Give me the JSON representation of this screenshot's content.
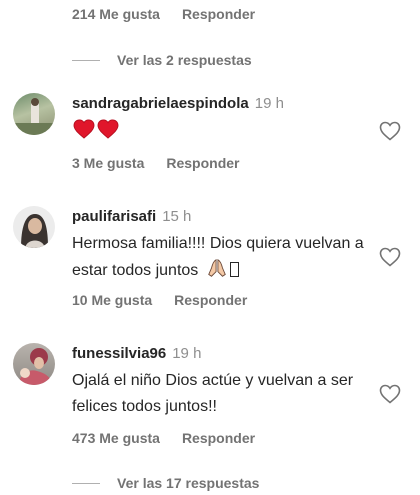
{
  "top": {
    "likes": "214 Me gusta",
    "reply": "Responder",
    "view_replies": "Ver las 2 respuestas"
  },
  "comments": [
    {
      "username": "sandragabrielaespindola",
      "time": "19 h",
      "text": "",
      "emoji_icons": [
        "red-heart-icon",
        "red-heart-icon"
      ],
      "likes": "3 Me gusta",
      "reply": "Responder"
    },
    {
      "username": "paulifarisafi",
      "time": "15 h",
      "text": "Hermosa familia!!!! Dios quiera vuelvan a estar todos juntos",
      "emoji_icons": [
        "praying-hands-icon",
        "missing-glyph-icon"
      ],
      "likes": "10 Me gusta",
      "reply": "Responder"
    },
    {
      "username": "funessilvia96",
      "time": "19 h",
      "text": "Ojalá el niño Dios actúe y vuelvan a ser felices todos juntos!!",
      "likes": "473 Me gusta",
      "reply": "Responder",
      "view_replies": "Ver las 17 respuestas"
    }
  ],
  "colors": {
    "heart_red": "#ed4956",
    "secondary_text": "#737373",
    "primary_text": "#262626"
  }
}
